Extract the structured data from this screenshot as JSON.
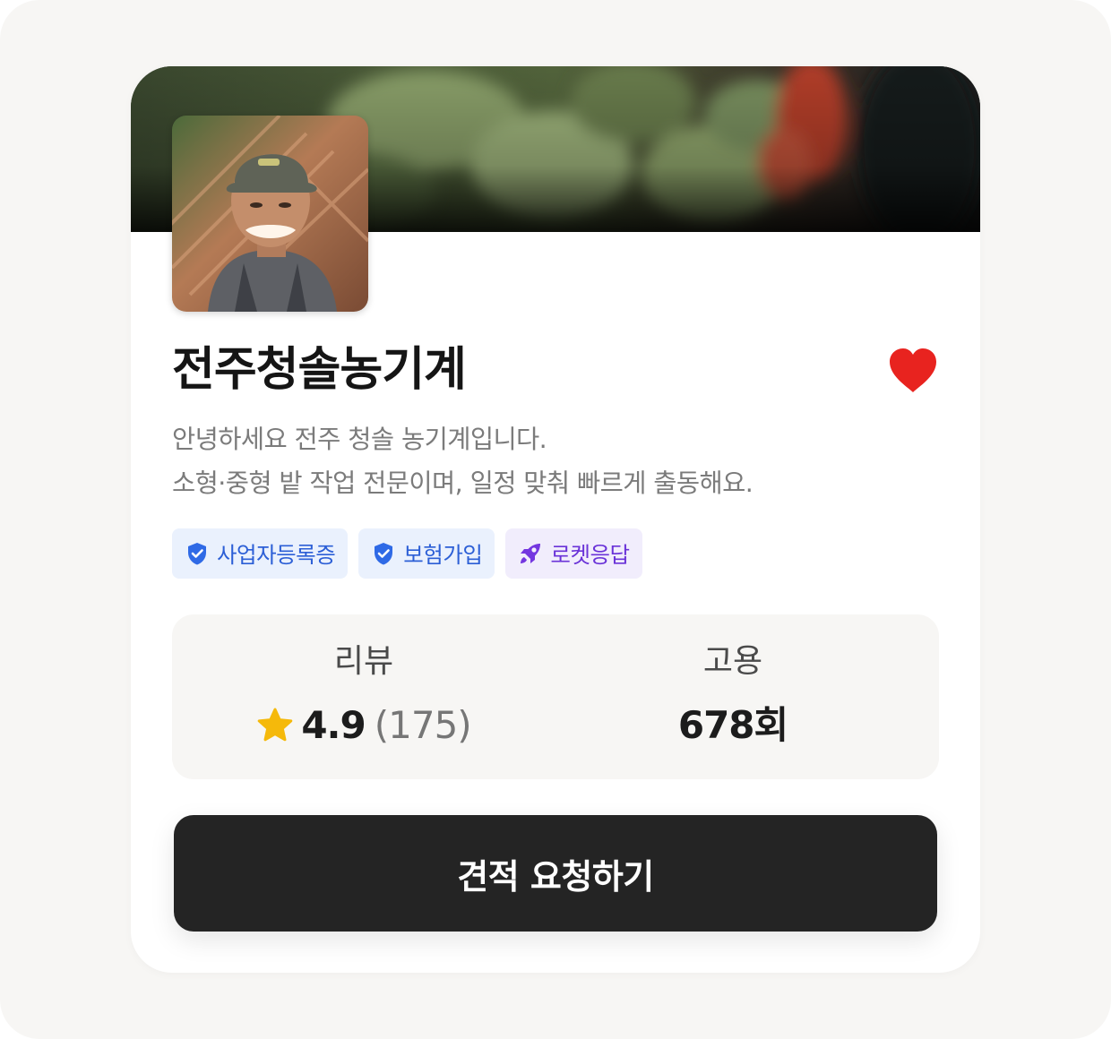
{
  "profile": {
    "name": "전주청솔농기계",
    "description_lines": [
      "안녕하세요 전주 청솔 농기계입니다.",
      "소형·중형 밭 작업 전문이며, 일정 맞춰 빠르게 출동해요."
    ],
    "favorited": true
  },
  "badges": [
    {
      "label": "사업자등록증",
      "icon": "shield-check-icon",
      "color": "#2c5fd6"
    },
    {
      "label": "보험가입",
      "icon": "shield-check-icon",
      "color": "#2c5fd6"
    },
    {
      "label": "로켓응답",
      "icon": "rocket-icon",
      "color": "#6a33d8"
    }
  ],
  "stats": {
    "review": {
      "label": "리뷰",
      "rating": "4.9",
      "count": "(175)"
    },
    "hire": {
      "label": "고용",
      "value": "678회"
    }
  },
  "cta": {
    "label": "견적 요청하기"
  },
  "colors": {
    "heart": "#e8231f",
    "star": "#f5b90b",
    "cta_background": "#242424"
  }
}
